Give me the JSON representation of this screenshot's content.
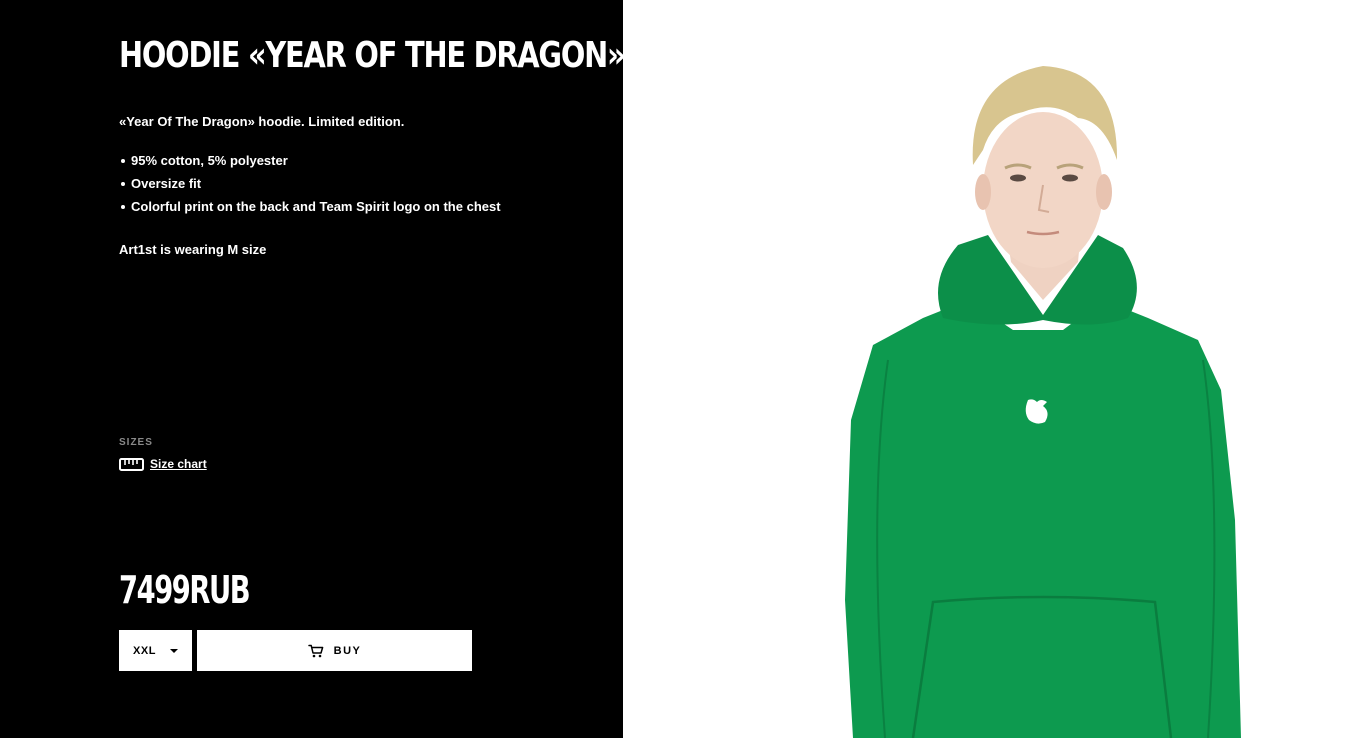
{
  "product": {
    "title": "HOODIE «YEAR OF THE DRAGON»",
    "description": "«Year Of The Dragon» hoodie. Limited edition.",
    "features": [
      "95% cotton, 5% polyester",
      "Oversize fit",
      "Colorful print on the back and Team Spirit logo on the chest"
    ],
    "model_note": "Art1st is wearing M size",
    "price": "7499RUB"
  },
  "sizes": {
    "label": "SIZES",
    "chart_label": "Size chart",
    "chart_icon": "ruler-icon",
    "selected": "XXL"
  },
  "actions": {
    "buy_label": "BUY",
    "buy_icon": "cart-icon"
  },
  "colors": {
    "panel_bg": "#000000",
    "text": "#ffffff",
    "muted": "#8a8a8a",
    "hoodie": "#0d9a4f",
    "image_bg": "#ffffff"
  }
}
